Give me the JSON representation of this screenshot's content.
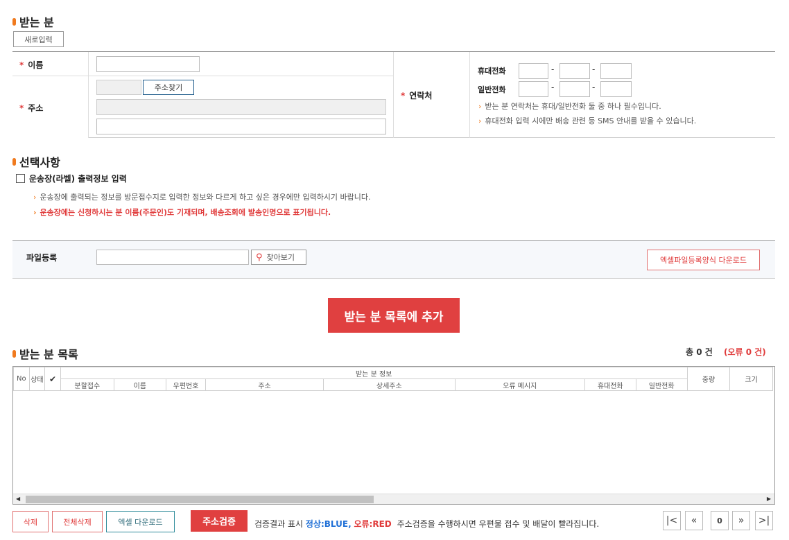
{
  "recipient": {
    "title": "받는 분",
    "new_input_label": "새로입력",
    "name_label": "이름",
    "address_label": "주소",
    "address_search_label": "주소찾기",
    "contact_label": "연락처",
    "mobile_label": "휴대전화",
    "phone_label": "일반전화",
    "dash": "-",
    "notes": [
      "받는 분 연락처는 휴대/일반전화 둘 중 하나 필수입니다.",
      "휴대전화 입력 시에만 배송 관련 등 SMS 안내를 받을 수 있습니다."
    ],
    "required_mark": "*"
  },
  "options": {
    "title": "선택사항",
    "checkbox_label": "운송장(라벨) 출력정보 입력",
    "notes": [
      "운송장에 출력되는 정보를 방문접수지로 입력한 정보와 다르게 하고 싶은 경우에만 입력하시기 바랍니다.",
      "운송장에는 신청하시는 분 이름(주문인)도 기재되며, 배송조회에 발송인명으로 표기됩니다."
    ],
    "bullet": "›"
  },
  "file": {
    "label": "파일등록",
    "browse_label": "찾아보기",
    "excel_template_label": "엑셀파일등록양식 다운로드"
  },
  "add_button_label": "받는 분 목록에 추가",
  "list": {
    "title": "받는 분 목록",
    "total_text": "총 0 건",
    "error_text": "(오류 0 건)",
    "columns_left": [
      "No",
      "상태",
      "✔"
    ],
    "group_header": "받는 분 정보",
    "sub_columns": [
      "분할접수",
      "이름",
      "우편번호",
      "주소",
      "상세주소",
      "오류 메시지",
      "휴대전화",
      "일반전화"
    ],
    "columns_right": [
      "중량",
      "크기"
    ]
  },
  "actions": {
    "delete_label": "삭제",
    "delete_all_label": "전체삭제",
    "excel_download_label": "엑셀 다운로드",
    "verify_label": "주소검증",
    "legend_prefix": "검증결과 표시",
    "legend_normal": "정상:BLUE,",
    "legend_error": "오류:RED",
    "legend_suffix": "주소검증을 수행하시면 우편물 접수 및 배달이 빨라집니다.",
    "page_first": "|<",
    "page_prev": "«",
    "page_current": "0",
    "page_next": "»",
    "page_last": ">|"
  },
  "colors": {
    "accent_orange": "#f07a1e",
    "primary_red": "#e04040",
    "blue": "#1f6fd6"
  }
}
